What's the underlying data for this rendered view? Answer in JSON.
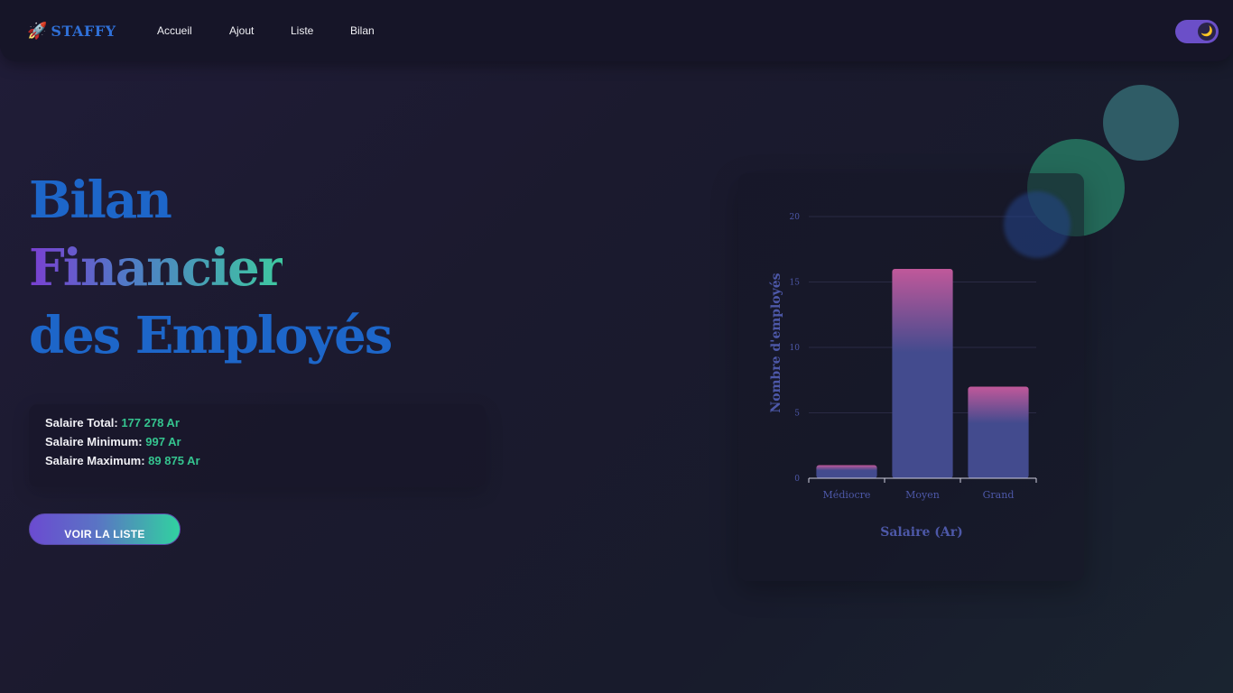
{
  "navbar": {
    "logo_icon": "🚀",
    "logo_text": "STAFFY",
    "links": [
      "Accueil",
      "Ajout",
      "Liste",
      "Bilan"
    ],
    "theme_toggle_icon": "moon-icon",
    "theme_toggle_glyph": "🌙"
  },
  "hero": {
    "title_line1": "Bilan",
    "title_line2": "Financier",
    "title_line3": "des Employés"
  },
  "stats": {
    "total_label": "Salaire Total:",
    "total_value": "177 278 Ar",
    "min_label": "Salaire Minimum:",
    "min_value": "997 Ar",
    "max_label": "Salaire Maximum:",
    "max_value": "89 875 Ar"
  },
  "cta": {
    "label": "VOIR LA LISTE"
  },
  "colors": {
    "accent_blue": "#1d66c9",
    "accent_green": "#35c48f",
    "accent_purple": "#6b4bd1",
    "bar_top": "#c0589a",
    "bar_bottom": "#434b8e"
  },
  "chart_data": {
    "type": "bar",
    "categories": [
      "Médiocre",
      "Moyen",
      "Grand"
    ],
    "values": [
      1,
      16,
      7
    ],
    "xlabel": "Salaire (Ar)",
    "ylabel": "Nombre d'employés",
    "ylim": [
      0,
      20
    ],
    "yticks": [
      0,
      5,
      10,
      15,
      20
    ],
    "grid": true,
    "legend": "none"
  }
}
